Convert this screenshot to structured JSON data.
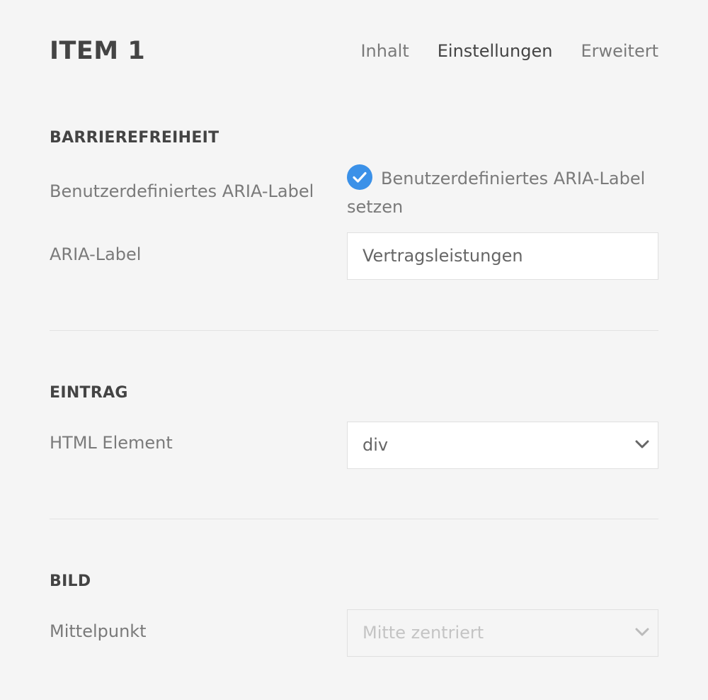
{
  "header": {
    "title": "ITEM 1",
    "tabs": [
      {
        "label": "Inhalt",
        "active": false
      },
      {
        "label": "Einstellungen",
        "active": true
      },
      {
        "label": "Erweitert",
        "active": false
      }
    ]
  },
  "sections": {
    "accessibility": {
      "title": "BARRIEREFREIHEIT",
      "custom_aria_label": "Benutzerdefiniertes ARIA-Label",
      "checkbox_label": "Benutzerdefiniertes ARIA-Label setzen",
      "checkbox_checked": true,
      "aria_label_label": "ARIA-Label",
      "aria_label_value": "Vertragsleistungen"
    },
    "entry": {
      "title": "EINTRAG",
      "html_element_label": "HTML Element",
      "html_element_value": "div"
    },
    "image": {
      "title": "BILD",
      "center_label": "Mittelpunkt",
      "center_value": "Mitte zentriert"
    }
  },
  "colors": {
    "background": "#f5f5f5",
    "accent": "#3b91e8",
    "text_dark": "#444444",
    "text_muted": "#7a7a7a"
  }
}
